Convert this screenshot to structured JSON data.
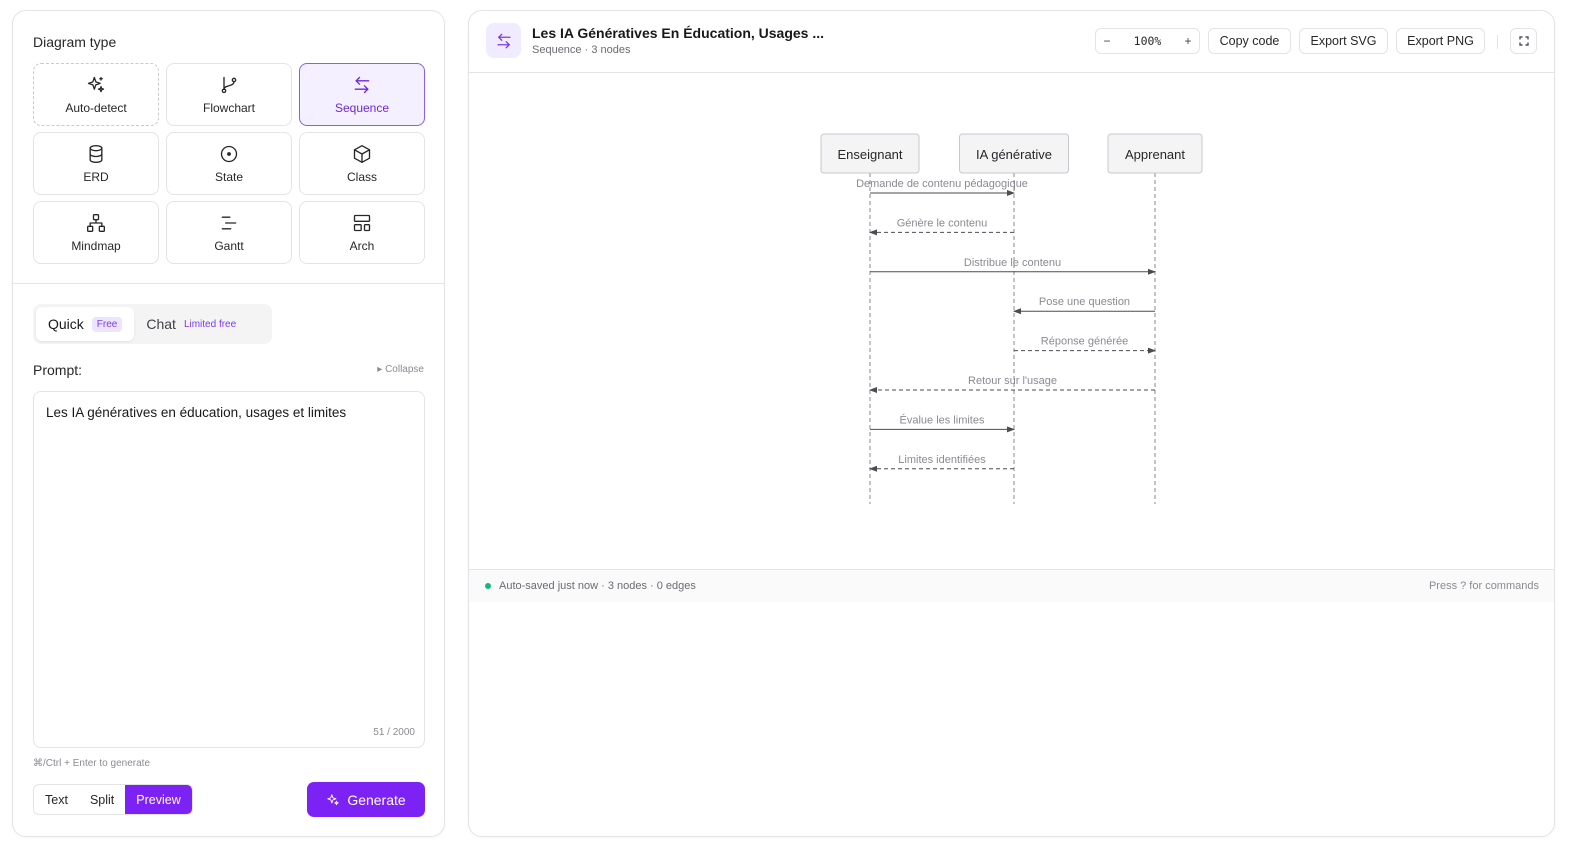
{
  "diagram_type": {
    "title": "Diagram type",
    "items": [
      {
        "label": "Auto-detect",
        "icon": "sparkles-icon"
      },
      {
        "label": "Flowchart",
        "icon": "git-branch-icon"
      },
      {
        "label": "Sequence",
        "icon": "arrows-swap-icon"
      },
      {
        "label": "ERD",
        "icon": "database-icon"
      },
      {
        "label": "State",
        "icon": "circle-dot-icon"
      },
      {
        "label": "Class",
        "icon": "cube-icon"
      },
      {
        "label": "Mindmap",
        "icon": "hierarchy-icon"
      },
      {
        "label": "Gantt",
        "icon": "gantt-bars-icon"
      },
      {
        "label": "Arch",
        "icon": "layout-grid-icon"
      }
    ],
    "selected": "Sequence"
  },
  "mode": {
    "quick_label": "Quick",
    "quick_badge": "Free",
    "chat_label": "Chat",
    "chat_badge": "Limited free"
  },
  "prompt": {
    "label": "Prompt:",
    "collapse_label": "▸ Collapse",
    "value": "Les IA génératives en éducation, usages et limites",
    "counter": "51 / 2000",
    "hint": "⌘/Ctrl + Enter to generate"
  },
  "view_modes": {
    "text": "Text",
    "split": "Split",
    "preview": "Preview",
    "selected": "Preview"
  },
  "generate_label": "Generate",
  "header": {
    "title": "Les IA Génératives En Éducation, Usages ...",
    "subtitle": "Sequence · 3 nodes",
    "zoom_minus": "−",
    "zoom_value": "100%",
    "zoom_plus": "+",
    "copy_code": "Copy code",
    "export_svg": "Export SVG",
    "export_png": "Export PNG"
  },
  "diagram": {
    "participants": [
      "Enseignant",
      "IA générative",
      "Apprenant"
    ],
    "messages": [
      {
        "from": 0,
        "to": 1,
        "text": "Demande de contenu pédagogique",
        "style": "solid"
      },
      {
        "from": 1,
        "to": 0,
        "text": "Génère le contenu",
        "style": "dashed"
      },
      {
        "from": 0,
        "to": 2,
        "text": "Distribue le contenu",
        "style": "solid"
      },
      {
        "from": 2,
        "to": 1,
        "text": "Pose une question",
        "style": "solid"
      },
      {
        "from": 1,
        "to": 2,
        "text": "Réponse générée",
        "style": "dashed"
      },
      {
        "from": 2,
        "to": 0,
        "text": "Retour sur l'usage",
        "style": "dashed"
      },
      {
        "from": 0,
        "to": 1,
        "text": "Évalue les limites",
        "style": "solid"
      },
      {
        "from": 1,
        "to": 0,
        "text": "Limites identifiées",
        "style": "dashed"
      }
    ]
  },
  "status": {
    "left": "Auto-saved just now · 3 nodes · 0 edges",
    "right": "Press ? for commands"
  },
  "colors": {
    "accent": "#7c22f5",
    "success": "#10b981"
  }
}
